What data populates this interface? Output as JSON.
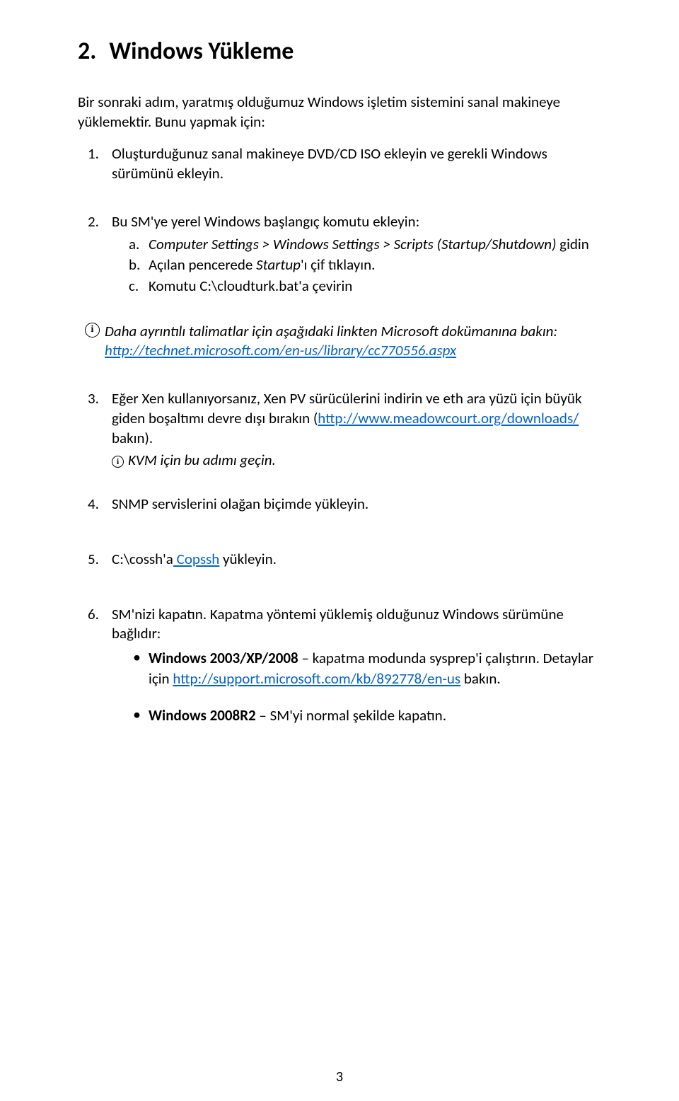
{
  "heading": {
    "number": "2.",
    "title": "Windows Yükleme"
  },
  "intro": "Bir sonraki adım, yaratmış olduğumuz Windows işletim sistemini sanal makineye yüklemektir. Bunu yapmak için:",
  "note": {
    "text": "Daha ayrıntılı talimatlar için aşağıdaki linkten Microsoft dokümanına bakın: ",
    "link_text": "http://technet.microsoft.com/en-us/library/cc770556.aspx"
  },
  "steps": {
    "s1": {
      "marker": "1.",
      "text": "Oluşturduğunuz sanal makineye DVD/CD ISO ekleyin ve gerekli Windows sürümünü ekleyin."
    },
    "s2": {
      "marker": "2.",
      "text": "Bu SM'ye yerel Windows başlangıç komutu ekleyin:",
      "a": {
        "marker": "a.",
        "before": "Computer Settings > Windows Settings > Scripts (Startup/Shutdown)",
        "after": " gidin"
      },
      "b": {
        "marker": "b.",
        "before": "Açılan pencerede ",
        "em": "Startup",
        "after": "'ı çif tıklayın."
      },
      "c": {
        "marker": "c.",
        "text": "Komutu C:\\cloudturk.bat'a çevirin"
      }
    },
    "s3": {
      "marker": "3.",
      "before": "Eğer Xen kullanıyorsanız, Xen PV sürücülerini indirin ve eth ara yüzü için büyük giden boşaltımı devre dışı bırakın (",
      "link_text": "http://www.meadowcourt.org/downloads/",
      "after": " bakın).",
      "note": "KVM için bu adımı geçin."
    },
    "s4": {
      "marker": "4.",
      "text": "SNMP servislerini olağan biçimde yükleyin."
    },
    "s5": {
      "marker": "5.",
      "before": "C:\\cossh'a",
      "link_text": " Copssh",
      "after": " yükleyin."
    },
    "s6": {
      "marker": "6.",
      "text": "SM'nizi kapatın. Kapatma yöntemi yüklemiş olduğunuz Windows sürümüne bağlıdır:",
      "b1": {
        "strong": "Windows 2003/XP/2008",
        "rest": " – kapatma modunda sysprep'i çalıştırın. Detaylar için ",
        "link_text": "http://support.microsoft.com/kb/892778/en-us",
        "after": " bakın."
      },
      "b2": {
        "strong": "Windows 2008R2",
        "rest": " – SM'yi normal şekilde kapatın."
      }
    }
  },
  "page_number": "3"
}
